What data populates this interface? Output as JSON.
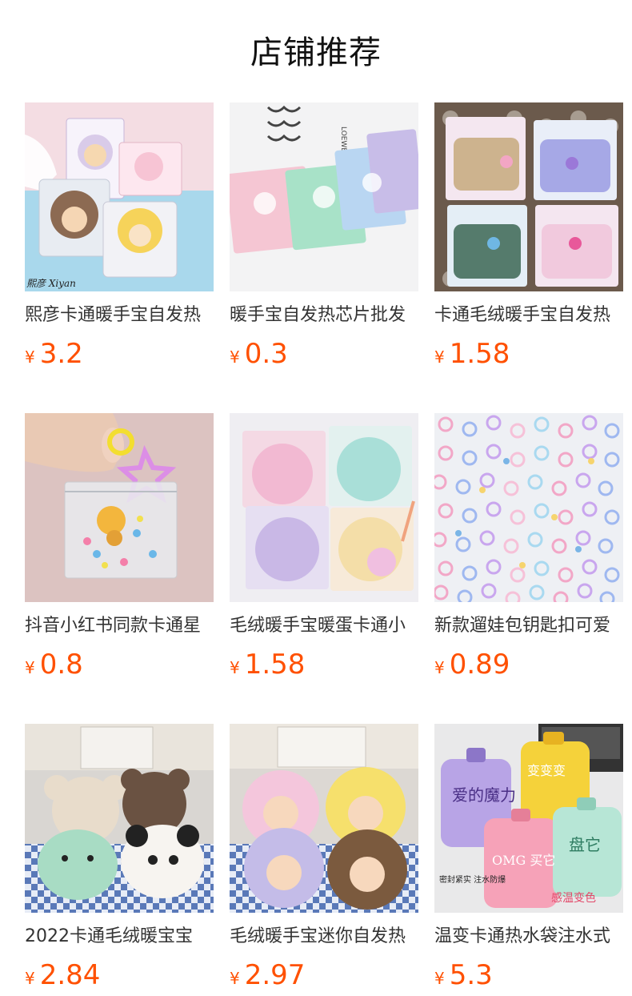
{
  "header": {
    "title": "店铺推荐"
  },
  "currency_symbol": "¥",
  "products": [
    {
      "name": "熙彦卡通暖手宝自发热",
      "price": "3.2"
    },
    {
      "name": "暖手宝自发热芯片批发",
      "price": "0.3"
    },
    {
      "name": "卡通毛绒暖手宝自发热",
      "price": "1.58"
    },
    {
      "name": "抖音小红书同款卡通星",
      "price": "0.8"
    },
    {
      "name": "毛绒暖手宝暖蛋卡通小",
      "price": "1.58"
    },
    {
      "name": "新款遛娃包钥匙扣可爱",
      "price": "0.89"
    },
    {
      "name": "2022卡通毛绒暖宝宝",
      "price": "2.84"
    },
    {
      "name": "毛绒暖手宝迷你自发热",
      "price": "2.97"
    },
    {
      "name": "温变卡通热水袋注水式",
      "price": "5.3"
    }
  ],
  "image_texts": {
    "p1_logo": "熙彦 Xiyan",
    "p2_brand": "LOEWE",
    "p9_bottle1": "爱的魔力",
    "p9_bottle2": "变变变",
    "p9_bottle3": "OMG 买它",
    "p9_bottle4": "盘它",
    "p9_caption_left": "密封紧实 注水防爆",
    "p9_caption_right": "感温变色"
  },
  "colors": {
    "price": "#ff5000",
    "title": "#111111",
    "name": "#333333"
  }
}
